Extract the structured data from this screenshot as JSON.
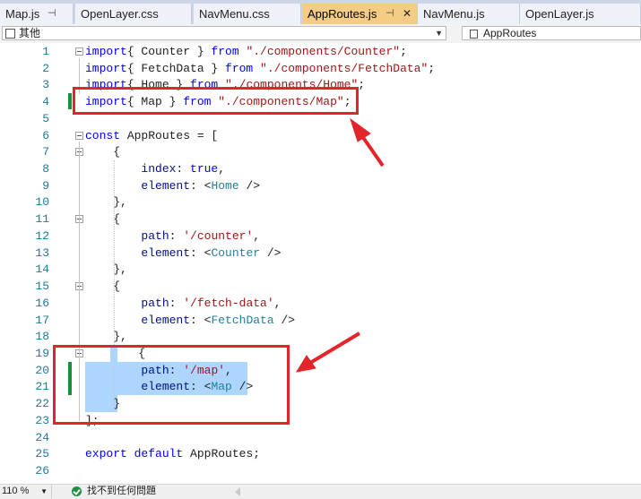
{
  "tabs": [
    {
      "label": "Map.js",
      "pinned": true,
      "active": false
    },
    {
      "label": "OpenLayer.css",
      "active": false
    },
    {
      "label": "NavMenu.css",
      "active": false
    },
    {
      "label": "AppRoutes.js",
      "pinned": true,
      "active": true
    },
    {
      "label": "NavMenu.js",
      "active": false
    },
    {
      "label": "OpenLayer.js",
      "active": false
    }
  ],
  "tab_icons": {
    "pin": "⊣",
    "close": "✕"
  },
  "navbar": {
    "project": "其他",
    "member": "AppRoutes"
  },
  "code_lines": [
    {
      "n": "1",
      "parts": [
        [
          "kw",
          "import"
        ],
        [
          "",
          "{ Counter } "
        ],
        [
          "kw",
          "from"
        ],
        [
          "",
          ""
        ],
        [
          "str",
          " \"./components/Counter\""
        ],
        [
          "",
          ";"
        ]
      ]
    },
    {
      "n": "2",
      "parts": [
        [
          "kw",
          "import"
        ],
        [
          "",
          "{ FetchData } "
        ],
        [
          "kw",
          "from"
        ],
        [
          "str",
          " \"./components/FetchData\""
        ],
        [
          "",
          ";"
        ]
      ]
    },
    {
      "n": "3",
      "parts": [
        [
          "kw",
          "import"
        ],
        [
          "",
          "{ Home } "
        ],
        [
          "kw",
          "from"
        ],
        [
          "str",
          " \"./components/Home\""
        ],
        [
          "",
          ";"
        ]
      ]
    },
    {
      "n": "4",
      "parts": [
        [
          "kw",
          "import"
        ],
        [
          "",
          "{ Map } "
        ],
        [
          "kw",
          "from"
        ],
        [
          "str",
          " \"./components/Map\""
        ],
        [
          "",
          ";"
        ]
      ]
    },
    {
      "n": "5",
      "parts": []
    },
    {
      "n": "6",
      "parts": [
        [
          "kw",
          "const"
        ],
        [
          "",
          " AppRoutes = ["
        ]
      ]
    },
    {
      "n": "7",
      "parts": [
        [
          "",
          "    {"
        ]
      ]
    },
    {
      "n": "8",
      "parts": [
        [
          "prop",
          "        index"
        ],
        [
          "",
          ": "
        ],
        [
          "kw",
          "true"
        ],
        [
          "",
          ","
        ]
      ]
    },
    {
      "n": "9",
      "parts": [
        [
          "prop",
          "        element"
        ],
        [
          "",
          ": <"
        ],
        [
          "tag",
          "Home"
        ],
        [
          "",
          " />"
        ]
      ]
    },
    {
      "n": "10",
      "parts": [
        [
          "",
          "    },"
        ]
      ]
    },
    {
      "n": "11",
      "parts": [
        [
          "",
          "    {"
        ]
      ]
    },
    {
      "n": "12",
      "parts": [
        [
          "prop",
          "        path"
        ],
        [
          "",
          ": "
        ],
        [
          "str",
          "'/counter'"
        ],
        [
          "",
          ","
        ]
      ]
    },
    {
      "n": "13",
      "parts": [
        [
          "prop",
          "        element"
        ],
        [
          "",
          ": <"
        ],
        [
          "tag",
          "Counter"
        ],
        [
          "",
          " />"
        ]
      ]
    },
    {
      "n": "14",
      "parts": [
        [
          "",
          "    },"
        ]
      ]
    },
    {
      "n": "15",
      "parts": [
        [
          "",
          "    {"
        ]
      ]
    },
    {
      "n": "16",
      "parts": [
        [
          "prop",
          "        path"
        ],
        [
          "",
          ": "
        ],
        [
          "str",
          "'/fetch-data'"
        ],
        [
          "",
          ","
        ]
      ]
    },
    {
      "n": "17",
      "parts": [
        [
          "prop",
          "        element"
        ],
        [
          "",
          ": <"
        ],
        [
          "tag",
          "FetchData"
        ],
        [
          "",
          " />"
        ]
      ]
    },
    {
      "n": "18",
      "parts": [
        [
          "",
          "    },"
        ]
      ]
    },
    {
      "n": "19",
      "parts": [
        [
          "",
          "    {"
        ]
      ]
    },
    {
      "n": "20",
      "parts": [
        [
          "prop",
          "        path"
        ],
        [
          "",
          ": "
        ],
        [
          "str",
          "'/map'"
        ],
        [
          "",
          ","
        ]
      ]
    },
    {
      "n": "21",
      "parts": [
        [
          "prop",
          "        element"
        ],
        [
          "",
          ": <"
        ],
        [
          "tag",
          "Map"
        ],
        [
          "",
          " />"
        ]
      ]
    },
    {
      "n": "22",
      "parts": [
        [
          "",
          "    }"
        ]
      ]
    },
    {
      "n": "23",
      "parts": [
        [
          "",
          "];"
        ]
      ]
    },
    {
      "n": "24",
      "parts": []
    },
    {
      "n": "25",
      "parts": [
        [
          "kw",
          "export"
        ],
        [
          "kw",
          " default"
        ],
        [
          "",
          " AppRoutes;"
        ]
      ]
    },
    {
      "n": "26",
      "parts": []
    }
  ],
  "status": {
    "zoom": "110 %",
    "issues": "找不到任何問題"
  },
  "colors": {
    "keyword": "#0000ff",
    "string": "#a31515",
    "property": "#001080",
    "tag": "#267f99",
    "selection": "#add6ff",
    "annotation": "#e3242b",
    "change_bar": "#1e8e3e"
  }
}
